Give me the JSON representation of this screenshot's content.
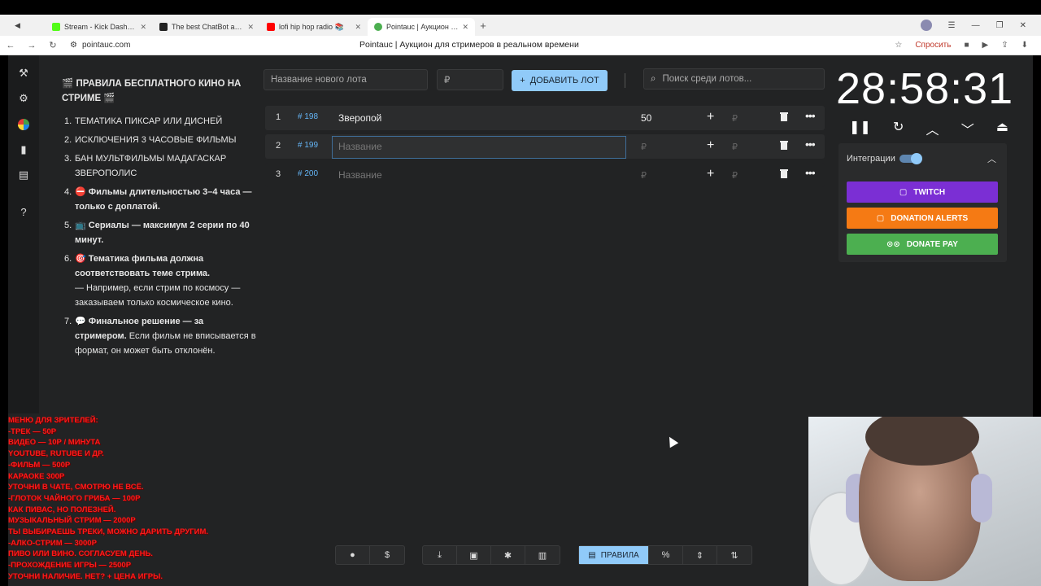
{
  "browser": {
    "tabs": [
      {
        "title": "Stream - Kick Dashboard",
        "color": "#53fc18"
      },
      {
        "title": "The best ChatBot and Wid",
        "color": "#222222"
      },
      {
        "title": "lofi hip hop radio 📚",
        "color": "#ff0000"
      },
      {
        "title": "Pointauc | Аукцион для",
        "color": "#4caf50"
      }
    ],
    "url": "pointauc.com",
    "page_title": "Pointauc | Аукцион для стримеров в реальном времени",
    "ask_label": "Спросить"
  },
  "rules": {
    "heading": "🎬 ПРАВИЛА БЕСПЛАТНОГО КИНО НА СТРИМЕ 🎬",
    "items": [
      {
        "num": "1.",
        "text": "ТЕМАТИКА ПИКСАР ИЛИ ДИСНЕЙ"
      },
      {
        "num": "2.",
        "text": "ИСКЛЮЧЕНИЯ  3 ЧАСОВЫЕ ФИЛЬМЫ"
      },
      {
        "num": "3.",
        "text": "БАН МУЛЬТФИЛЬМЫ МАДАГАСКАР ЗВЕРОПОЛИС"
      },
      {
        "num": "4.",
        "text": "⛔ Фильмы длительностью 3–4 часа — только с доплатой."
      },
      {
        "num": "5.",
        "text": "📺 Сериалы — максимум 2 серии по 40 минут."
      },
      {
        "num": "6.",
        "text": "🎯 Тематика фильма должна соответствовать теме стрима.",
        "sub": "— Например, если стрим по космосу — заказываем только космическое кино."
      },
      {
        "num": "7.",
        "text": "💬 Финальное решение — за стримером.",
        "sub": "Если фильм не вписывается в формат, он может быть отклонён."
      }
    ]
  },
  "controls": {
    "lot_name_placeholder": "Название нового лота",
    "amount_placeholder": "₽",
    "add_lot_label": "ДОБАВИТЬ ЛОТ",
    "search_placeholder": "Поиск среди лотов..."
  },
  "lots": [
    {
      "index": "1",
      "id": "198",
      "name": "Зверопой",
      "amount": "50",
      "name_placeholder": "",
      "amount_placeholder": ""
    },
    {
      "index": "2",
      "id": "199",
      "name": "",
      "amount": "",
      "name_placeholder": "Название",
      "amount_placeholder": "₽"
    },
    {
      "index": "3",
      "id": "200",
      "name": "",
      "amount": "",
      "name_placeholder": "Название",
      "amount_placeholder": "₽"
    }
  ],
  "lot_add_currency": "₽",
  "timer": {
    "value": "28:58:31"
  },
  "integrations": {
    "label": "Интеграции",
    "buttons": [
      {
        "label": "TWITCH",
        "color": "#7b2fd4"
      },
      {
        "label": "DONATION ALERTS",
        "color": "#f57a14"
      },
      {
        "label": "DONATE PAY",
        "color": "#4caf50"
      }
    ]
  },
  "overlay_menu": [
    "МЕНЮ ДЛЯ ЗРИТЕЛЕЙ:",
    "-ТРЕК — 50Р",
    "ВИДЕО — 10Р / МИНУТА",
    "YOUTUBE, RUTUBE И ДР.",
    "-ФИЛЬМ — 500Р",
    "КАРАОКЕ 300Р",
    "УТОЧНИ В ЧАТЕ, СМОТРЮ НЕ ВСЁ.",
    "-ГЛОТОК ЧАЙНОГО ГРИБА — 100Р",
    "КАК ПИВАС, НО ПОЛЕЗНЕЙ.",
    "МУЗЫКАЛЬНЫЙ СТРИМ — 2000Р",
    "ТЫ ВЫБИРАЕШЬ ТРЕКИ, МОЖНО ДАРИТЬ ДРУГИМ.",
    "-АЛКО-СТРИМ — 3000Р",
    "ПИВО ИЛИ ВИНО. СОГЛАСУЕМ ДЕНЬ.",
    "-ПРОХОЖДЕНИЕ ИГРЫ — 2500Р",
    "УТОЧНИ НАЛИЧИЕ. НЕТ? + ЦЕНА ИГРЫ."
  ],
  "toolbar": {
    "rules_label": "ПРАВИЛА"
  }
}
